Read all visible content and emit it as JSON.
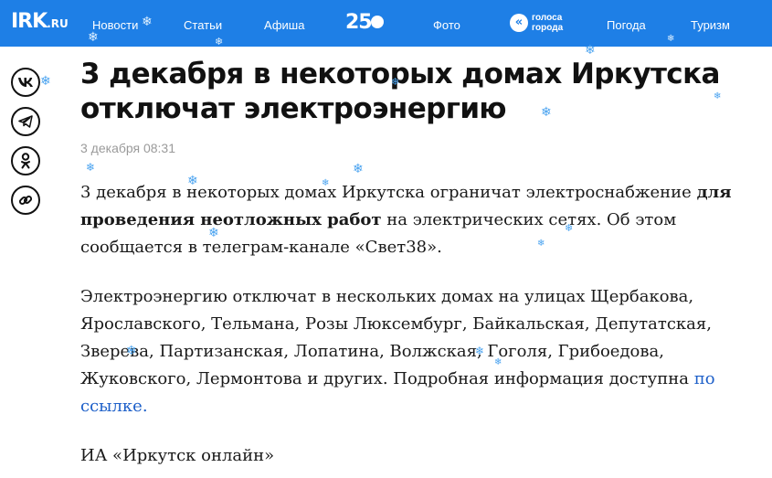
{
  "header": {
    "logo_main": "IRK",
    "logo_domain": ".RU",
    "nav": [
      {
        "label": "Новости"
      },
      {
        "label": "Статьи"
      },
      {
        "label": "Афиша"
      },
      {
        "label": "Фото"
      },
      {
        "label": "Погода"
      },
      {
        "label": "Туризм"
      }
    ],
    "anniversary": "25",
    "golosa_line1": "голоса",
    "golosa_line2": "города"
  },
  "share": [
    {
      "icon": "vk-icon"
    },
    {
      "icon": "telegram-icon"
    },
    {
      "icon": "odnoklassniki-icon"
    },
    {
      "icon": "link-icon"
    }
  ],
  "article": {
    "title": "3 декабря в некоторых домах Иркутска отключат электроэнергию",
    "date": "3 декабря 08:31",
    "p1_before": "3 декабря в некоторых домах Иркутска ограничат электроснабжение ",
    "p1_bold": "для проведения неотложных работ",
    "p1_after": " на электрических сетях. Об этом сообщается в телеграм-канале «Свет38».",
    "p2_text": "Электроэнергию отключат в нескольких домах на улицах Щербакова, Ярославского, Тельмана, Розы Люксембург, Байкальская, Депутатская, Зверева, Партизанская, Лопатина, Волжская, Гоголя, Грибоедова, Жуковского, Лермонтова и других. Подробная информация доступна ",
    "p2_link": "по ссылке.",
    "p3": "ИА «Иркутск онлайн»"
  },
  "colors": {
    "header_bg": "#1e7fe6",
    "link": "#1e60c9",
    "snow": "#4aa3f0"
  }
}
